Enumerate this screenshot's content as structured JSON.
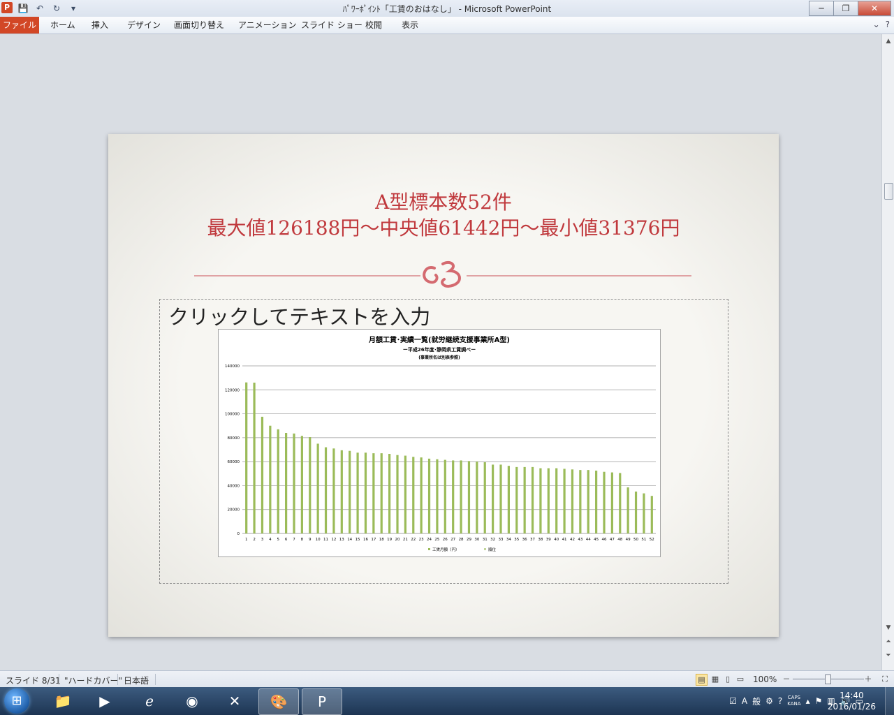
{
  "window": {
    "app_icon": "P",
    "title": "ﾊﾟﾜｰﾎﾟｲﾝﾄ「工賃のおはなし」 - Microsoft PowerPoint",
    "minimize": "─",
    "restore": "❐",
    "close": "✕"
  },
  "qat": {
    "save": "💾",
    "undo": "↶",
    "redo": "↻",
    "customize": "▾"
  },
  "ribbon": {
    "tabs": [
      "ファイル",
      "ホーム",
      "挿入",
      "デザイン",
      "画面切り替え",
      "アニメーション",
      "スライド ショー",
      "校閲",
      "表示"
    ],
    "help_caret": "⌄",
    "help": "?"
  },
  "slide": {
    "title_line1": "A型標本数52件",
    "title_line2": "最大値126188円～中央値61442円～最小値31376円",
    "placeholder_text": "クリックしてテキストを入力",
    "ornament_glyph": "ↄ",
    "accent_color": "#c0393d"
  },
  "chart_data": {
    "type": "bar",
    "title": "月額工賃･実績一覧(就労継続支援事業所A型)",
    "subtitle": "ー平成26年度･静岡県工賃調べー",
    "note": "(事業所名は別表参照)",
    "categories": [
      "1",
      "2",
      "3",
      "4",
      "5",
      "6",
      "7",
      "8",
      "9",
      "10",
      "11",
      "12",
      "13",
      "14",
      "15",
      "16",
      "17",
      "18",
      "19",
      "20",
      "21",
      "22",
      "23",
      "24",
      "25",
      "26",
      "27",
      "28",
      "29",
      "30",
      "31",
      "32",
      "33",
      "34",
      "35",
      "36",
      "37",
      "38",
      "39",
      "40",
      "41",
      "42",
      "43",
      "44",
      "45",
      "46",
      "47",
      "48",
      "49",
      "50",
      "51",
      "52"
    ],
    "series": [
      {
        "name": "工賃月額（円）",
        "color": "#9bbb59",
        "values": [
          126188,
          126000,
          97500,
          90000,
          87000,
          84000,
          83500,
          81500,
          80500,
          75000,
          72000,
          71000,
          69500,
          69000,
          67500,
          67500,
          67000,
          67000,
          66500,
          65500,
          65000,
          64000,
          63500,
          62500,
          62000,
          61500,
          61000,
          61000,
          60500,
          60000,
          59500,
          57500,
          57500,
          56500,
          55500,
          55500,
          55500,
          54500,
          54500,
          54500,
          54000,
          53500,
          53000,
          53000,
          52500,
          51500,
          51000,
          50500,
          38500,
          35000,
          33500,
          31376
        ]
      },
      {
        "name": "順位",
        "color": "#c3d69b",
        "values": []
      }
    ],
    "ylim": [
      0,
      140000
    ],
    "yticks": [
      "0",
      "20000",
      "40000",
      "60000",
      "80000",
      "100000",
      "120000",
      "140000"
    ],
    "grid": true,
    "legend": "bottom"
  },
  "status": {
    "slide_indicator": "スライド 8/31",
    "theme": "\"ハードカバー\"",
    "language": "日本語",
    "zoom": "100%",
    "zoom_out": "－",
    "zoom_in": "＋"
  },
  "taskbar": {
    "apps": [
      "explorer",
      "media-player",
      "internet-explorer",
      "chrome",
      "excel",
      "paint",
      "powerpoint"
    ],
    "tray_text": [
      "A",
      "般",
      "CAPS",
      "KANA"
    ],
    "time": "14:40",
    "date": "2016/01/26"
  }
}
